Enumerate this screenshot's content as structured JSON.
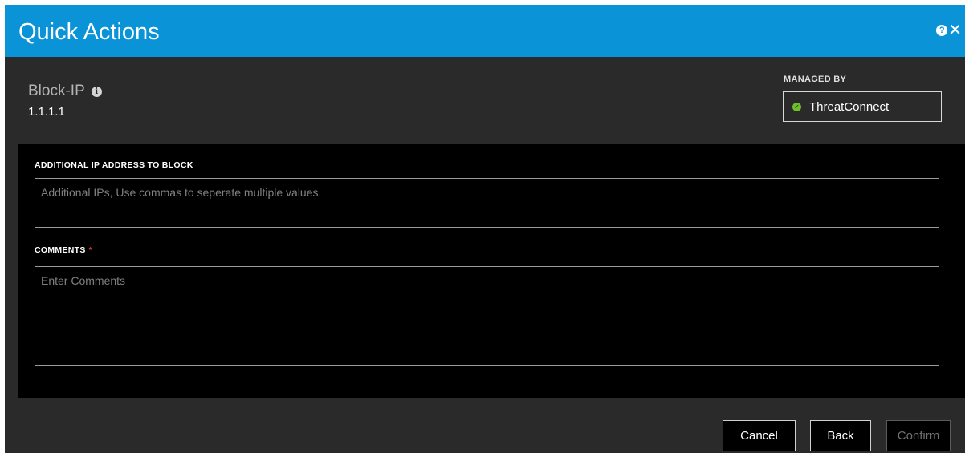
{
  "dialog": {
    "title": "Quick Actions",
    "help_icon": "help-circle-icon",
    "close_icon": "close-icon"
  },
  "action": {
    "name": "Block-IP",
    "info_icon": "info-icon",
    "target": "1.1.1.1"
  },
  "managed_by": {
    "label": "MANAGED BY",
    "status_icon": "check-circle-icon",
    "status_color": "#6fbf2a",
    "name": "ThreatConnect"
  },
  "form": {
    "additional_ip": {
      "label": "ADDITIONAL IP ADDRESS TO BLOCK",
      "placeholder": "Additional IPs, Use commas to seperate multiple values.",
      "value": ""
    },
    "comments": {
      "label": "COMMENTS",
      "required_mark": "*",
      "placeholder": "Enter Comments",
      "value": ""
    }
  },
  "buttons": {
    "cancel": "Cancel",
    "back": "Back",
    "confirm": "Confirm"
  },
  "colors": {
    "header": "#0b93d8",
    "dialog_bg": "#2a2a2a",
    "panel_bg": "#000000",
    "required": "#e0323a"
  }
}
